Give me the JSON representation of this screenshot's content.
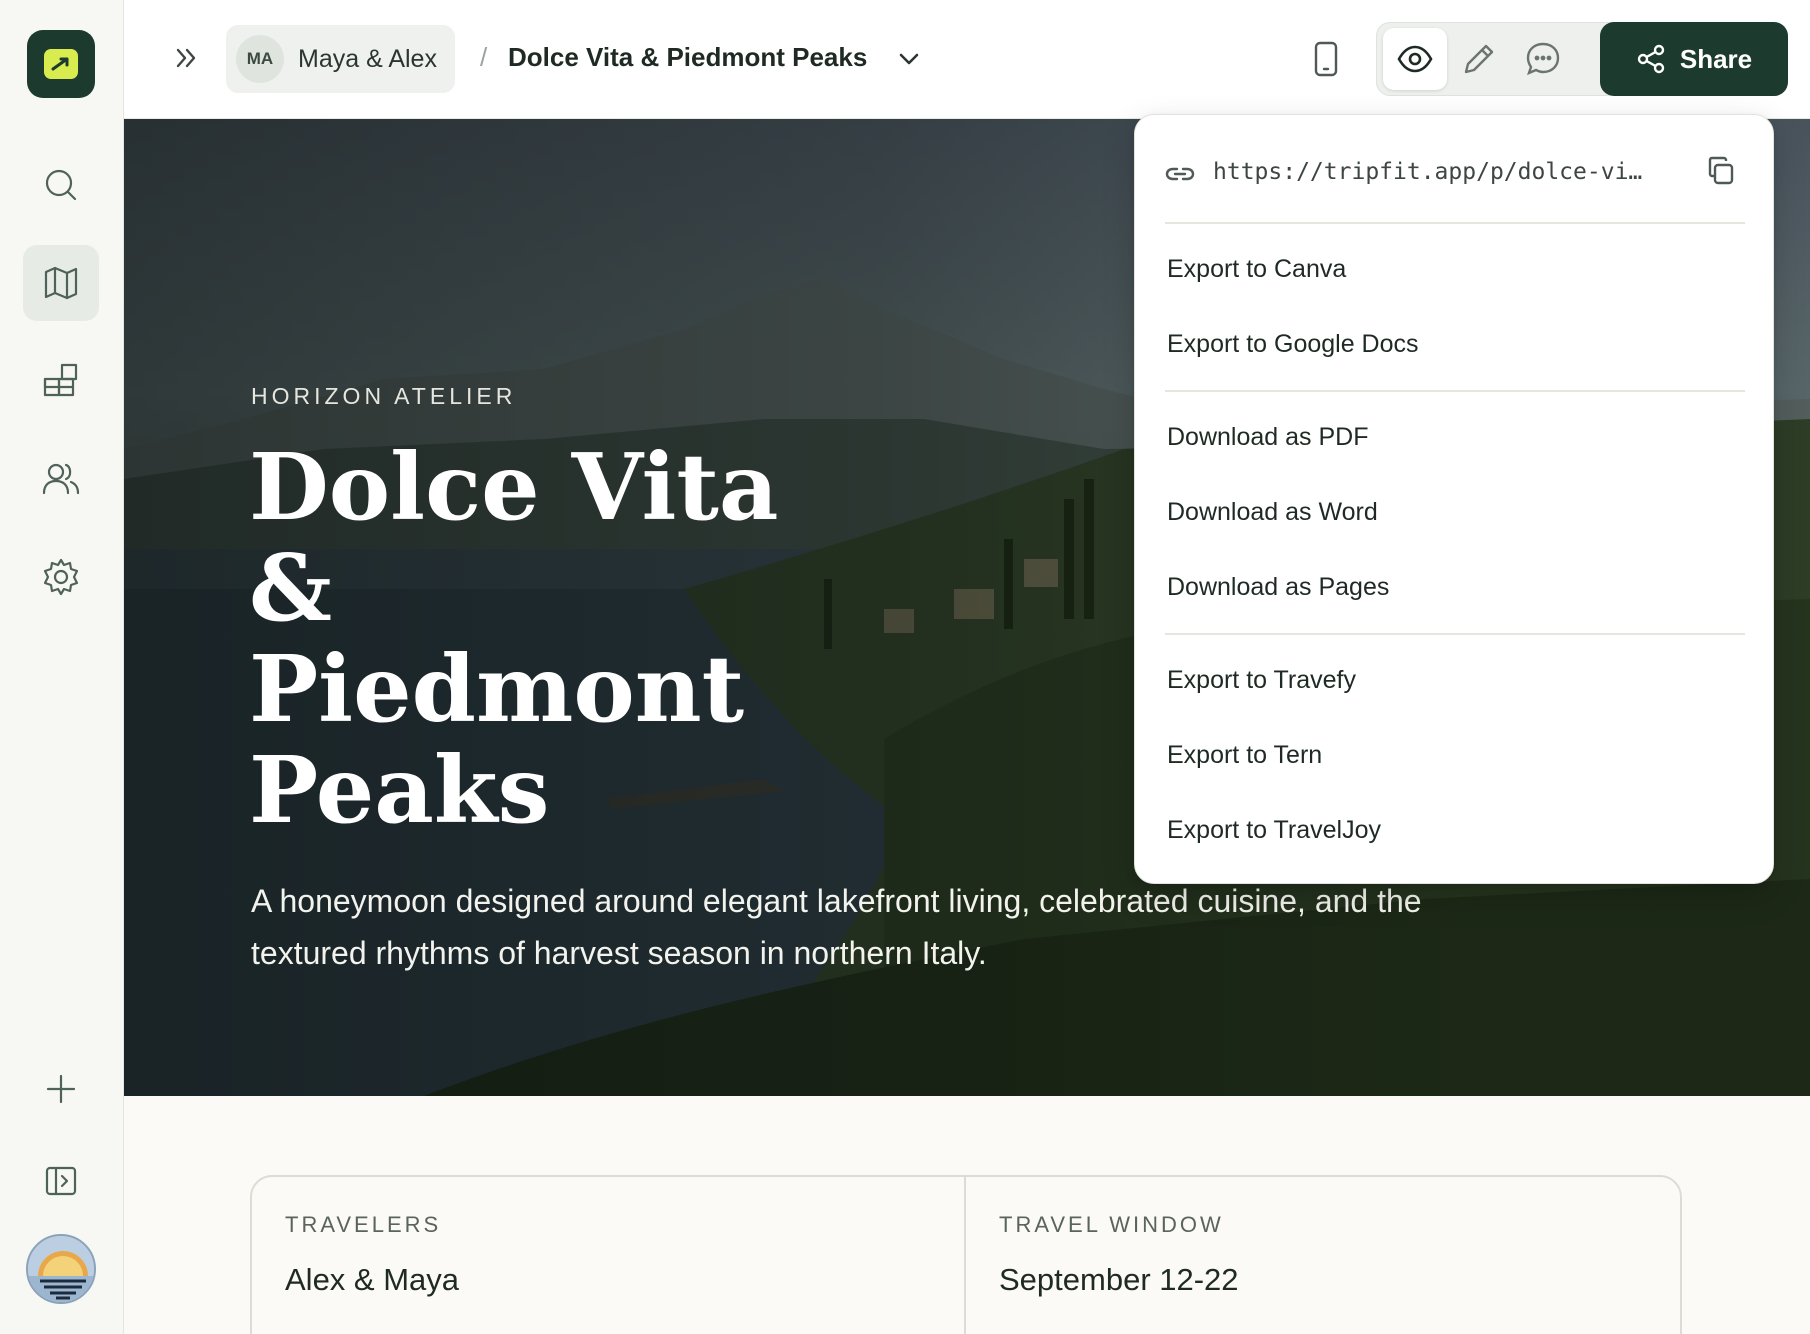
{
  "workspace": {
    "initials": "MA",
    "name": "Maya & Alex"
  },
  "breadcrumb": {
    "separator": "/",
    "doc_title": "Dolce Vita & Piedmont Peaks"
  },
  "toolbar": {
    "share_label": "Share"
  },
  "hero": {
    "eyebrow": "HORIZON ATELIER",
    "title": "Dolce Vita & Piedmont Peaks",
    "subtitle": "A honeymoon designed around elegant lakefront living, celebrated cuisine, and the textured rhythms of harvest season in northern Italy."
  },
  "info": {
    "travelers_label": "TRAVELERS",
    "travelers_value": "Alex & Maya",
    "window_label": "TRAVEL WINDOW",
    "window_value": "September 12-22"
  },
  "share_menu": {
    "link": "https://tripfit.app/p/dolce-vi…",
    "items": [
      "Export to Canva",
      "Export to Google Docs",
      "Download as PDF",
      "Download as Word",
      "Download as Pages",
      "Export to Travefy",
      "Export to Tern",
      "Export to TravelJoy"
    ]
  },
  "icons": {
    "rail": [
      "search-icon",
      "map-icon",
      "widgets-icon",
      "users-icon",
      "settings-icon",
      "plus-icon",
      "panel-toggle-icon"
    ],
    "modes": [
      "eye-icon",
      "pencil-icon",
      "comment-icon"
    ]
  },
  "colors": {
    "brand_dark": "#1c3a2e",
    "brand_accent": "#d8ec4f",
    "content_bg": "#fbfaf6"
  }
}
